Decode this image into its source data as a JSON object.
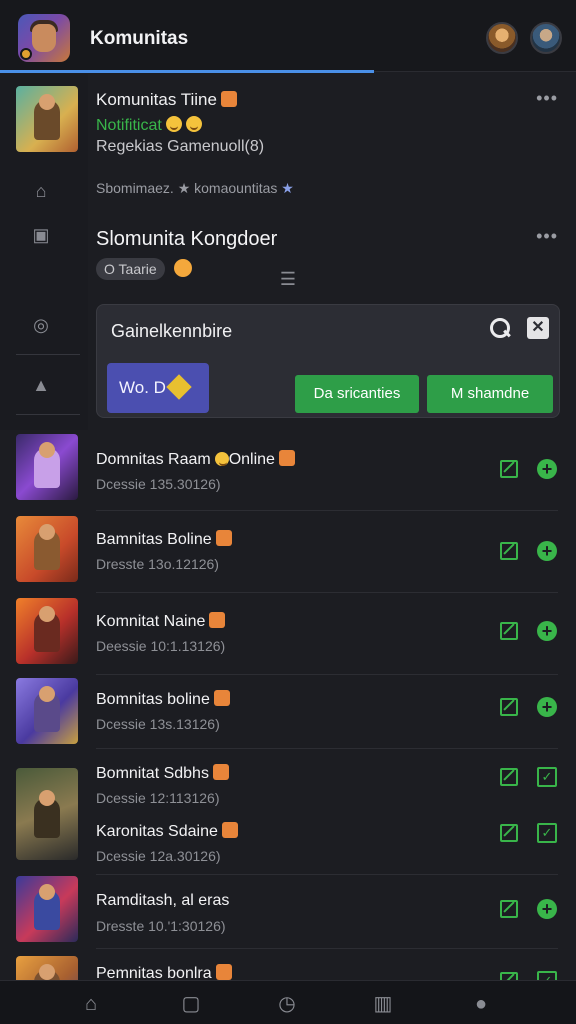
{
  "header": {
    "title": "Komunitas",
    "progress_fraction": 0.65,
    "accent_color": "#4a90e8"
  },
  "featured": {
    "title": "Komunitas Tiine",
    "status": "Notifiticat",
    "subtitle": "Regekias Gamenuoll(8)",
    "meta": "Sbomimaez. ★ komaountitas",
    "more": "•••"
  },
  "group": {
    "title": "Slomunita Kongdoer",
    "pill": "O Taarie",
    "more": "•••",
    "panel": {
      "title": "Gainelkennbire",
      "chip_label": "Wo. D",
      "button_1": "Da sricanties",
      "button_2": "M shamdne",
      "close_glyph": "✕"
    }
  },
  "rows": [
    {
      "title": "Domnitas Raam",
      "title_suffix": "Online",
      "meta": "Dcessie 135.30126)",
      "action": "add",
      "thumb_color": "#6a3ab0"
    },
    {
      "title": "Bamnitas Boline",
      "meta": "Dresste 13o.12126)",
      "action": "add",
      "thumb_color": "#d8603a"
    },
    {
      "title": "Komnitat Naine",
      "meta": "Deessie 10:1.13126)",
      "action": "add",
      "thumb_color": "#c8402a"
    },
    {
      "title": "Bomnitas boline",
      "meta": "Dcessie 13s.13126)",
      "action": "add",
      "thumb_color": "#7a5ad0"
    },
    {
      "title": "Bomnitat Sdbhs",
      "meta": "Dcessie 12:113126)",
      "action": "check",
      "thumb_color": "#5a6a4a"
    },
    {
      "title": "Karonitas Sdaine",
      "meta": "Dcessie 12a.30126)",
      "action": "check",
      "thumb_color": "#5a6a4a"
    },
    {
      "title": "Ramditash, al eras",
      "meta": "Dresste 10.'1:30126)",
      "action": "add",
      "thumb_color": "#a03a5a"
    },
    {
      "title": "Pemnitas bonlra",
      "meta": "",
      "action": "check",
      "thumb_color": "#c89040"
    }
  ],
  "icons": {
    "more": "more-dots-icon",
    "nav": [
      "home-icon",
      "card-icon",
      "timer-icon",
      "chart-icon",
      "user-icon"
    ]
  },
  "colors": {
    "background": "#1c1d22",
    "green": "#39b54a",
    "button_green": "#2e9e48",
    "chip_purple": "#4b4fb0"
  }
}
